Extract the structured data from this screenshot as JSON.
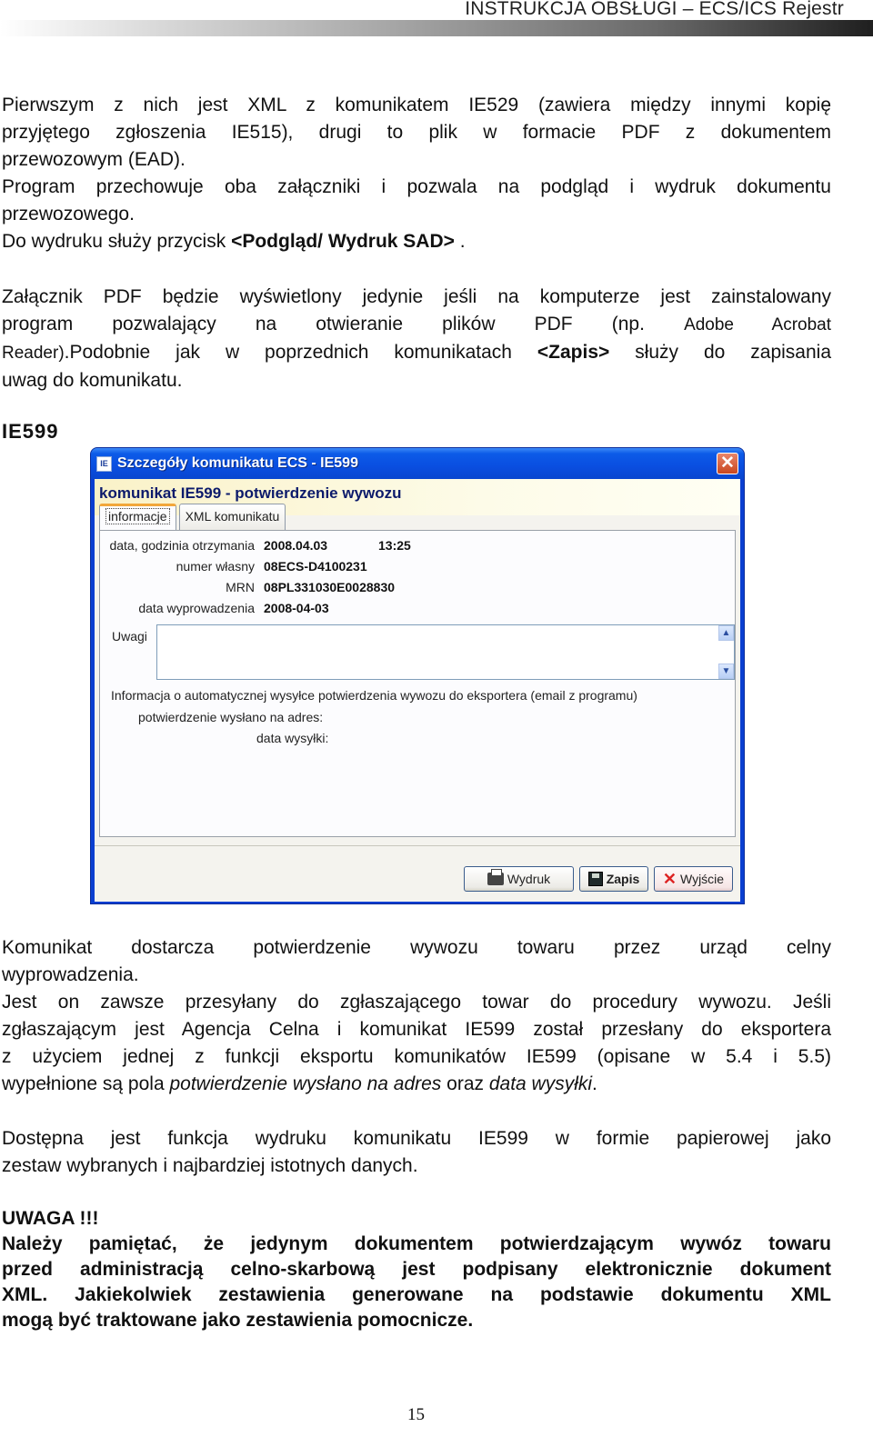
{
  "header": {
    "title": "INSTRUKCJA OBSŁUGI – ECS/ICS Rejestr"
  },
  "intro": {
    "p1_lines": [
      "Pierwszym z nich jest XML z komunikatem IE529 (zawiera między innymi kopię",
      "przyjętego zgłoszenia IE515), drugi to plik w formacie PDF z dokumentem",
      "przewozowym (EAD)."
    ],
    "p2_lines": [
      "Program przechowuje oba załączniki i pozwala na podgląd i wydruk dokumentu",
      "przewozowego."
    ],
    "p3_prefix": "Do wydruku służy przycisk ",
    "p3_bold": "<Podgląd/ Wydruk SAD>",
    "p3_suffix": " ."
  },
  "pdf_note": {
    "line1": "Załącznik PDF będzie wyświetlony jedynie jeśli na komputerze jest zainstalowany",
    "line2_main": "program pozwalający na otwieranie plików PDF (np.",
    "line2_small": "Adobe Acrobat",
    "line3_small": "Reader)",
    "line3_main": ".Podobnie jak w poprzednich komunikatach ",
    "line3_bold": "<Zapis>",
    "line3_end": " służy do zapisania",
    "line4": "uwag do komunikatu."
  },
  "section_heading": "IE599",
  "dialog": {
    "title": "Szczegóły komunikatu ECS - IE599",
    "app_icon": "IE",
    "heading": "komunikat IE599 - potwierdzenie wywozu",
    "tabs": [
      {
        "label": "informacje",
        "active": true
      },
      {
        "label": "XML komunikatu",
        "active": false
      }
    ],
    "fields": [
      {
        "label": "data, godzinia otrzymania",
        "value": "2008.04.03",
        "value2": "13:25"
      },
      {
        "label": "numer własny",
        "value": "08ECS-D4100231"
      },
      {
        "label": "MRN",
        "value": "08PL331030E0028830"
      },
      {
        "label": "data wyprowadzenia",
        "value": "2008-04-03"
      }
    ],
    "remarks_label": "Uwagi",
    "remarks_value": "",
    "info_text": "Informacja o automatycznej wysyłce potwierdzenia wywozu do eksportera (email z programu)",
    "sent_to_label": "potwierdzenie wysłano na adres:",
    "sent_date_label": "data wysyłki:",
    "buttons": {
      "print": "Wydruk",
      "save": "Zapis",
      "exit": "Wyjście"
    },
    "close_glyph": "✕",
    "scroll_up": "▲",
    "scroll_down": "▼"
  },
  "body": {
    "p1_lines": [
      "Komunikat dostarcza potwierdzenie wywozu towaru przez urząd celny",
      "wyprowadzenia.",
      "Jest on zawsze przesyłany do zgłaszającego towar do procedury wywozu. Jeśli",
      "zgłaszającym jest Agencja Celna i komunikat IE599 został przesłany do eksportera",
      "z użyciem jednej z funkcji eksportu komunikatów IE599 (opisane w 5.4 i 5.5)"
    ],
    "p1_last_a": "wypełnione są pola ",
    "p1_last_i1": "potwierdzenie wysłano na adres",
    "p1_last_b": " oraz ",
    "p1_last_i2": "data wysyłki",
    "p1_last_c": ".",
    "p2_lines": [
      "Dostępna jest funkcja wydruku komunikatu IE599 w formie papierowej jako",
      "zestaw wybranych i najbardziej istotnych danych."
    ]
  },
  "warning": {
    "title": "UWAGA !!!",
    "lines": [
      "Należy pamiętać, że jedynym dokumentem potwierdzającym wywóz towaru",
      "przed administracją celno-skarbową jest podpisany elektronicznie dokument",
      "XML. Jakiekolwiek zestawienia generowane na podstawie dokumentu XML",
      "mogą być traktowane jako zestawienia pomocnicze."
    ]
  },
  "page_number": "15"
}
